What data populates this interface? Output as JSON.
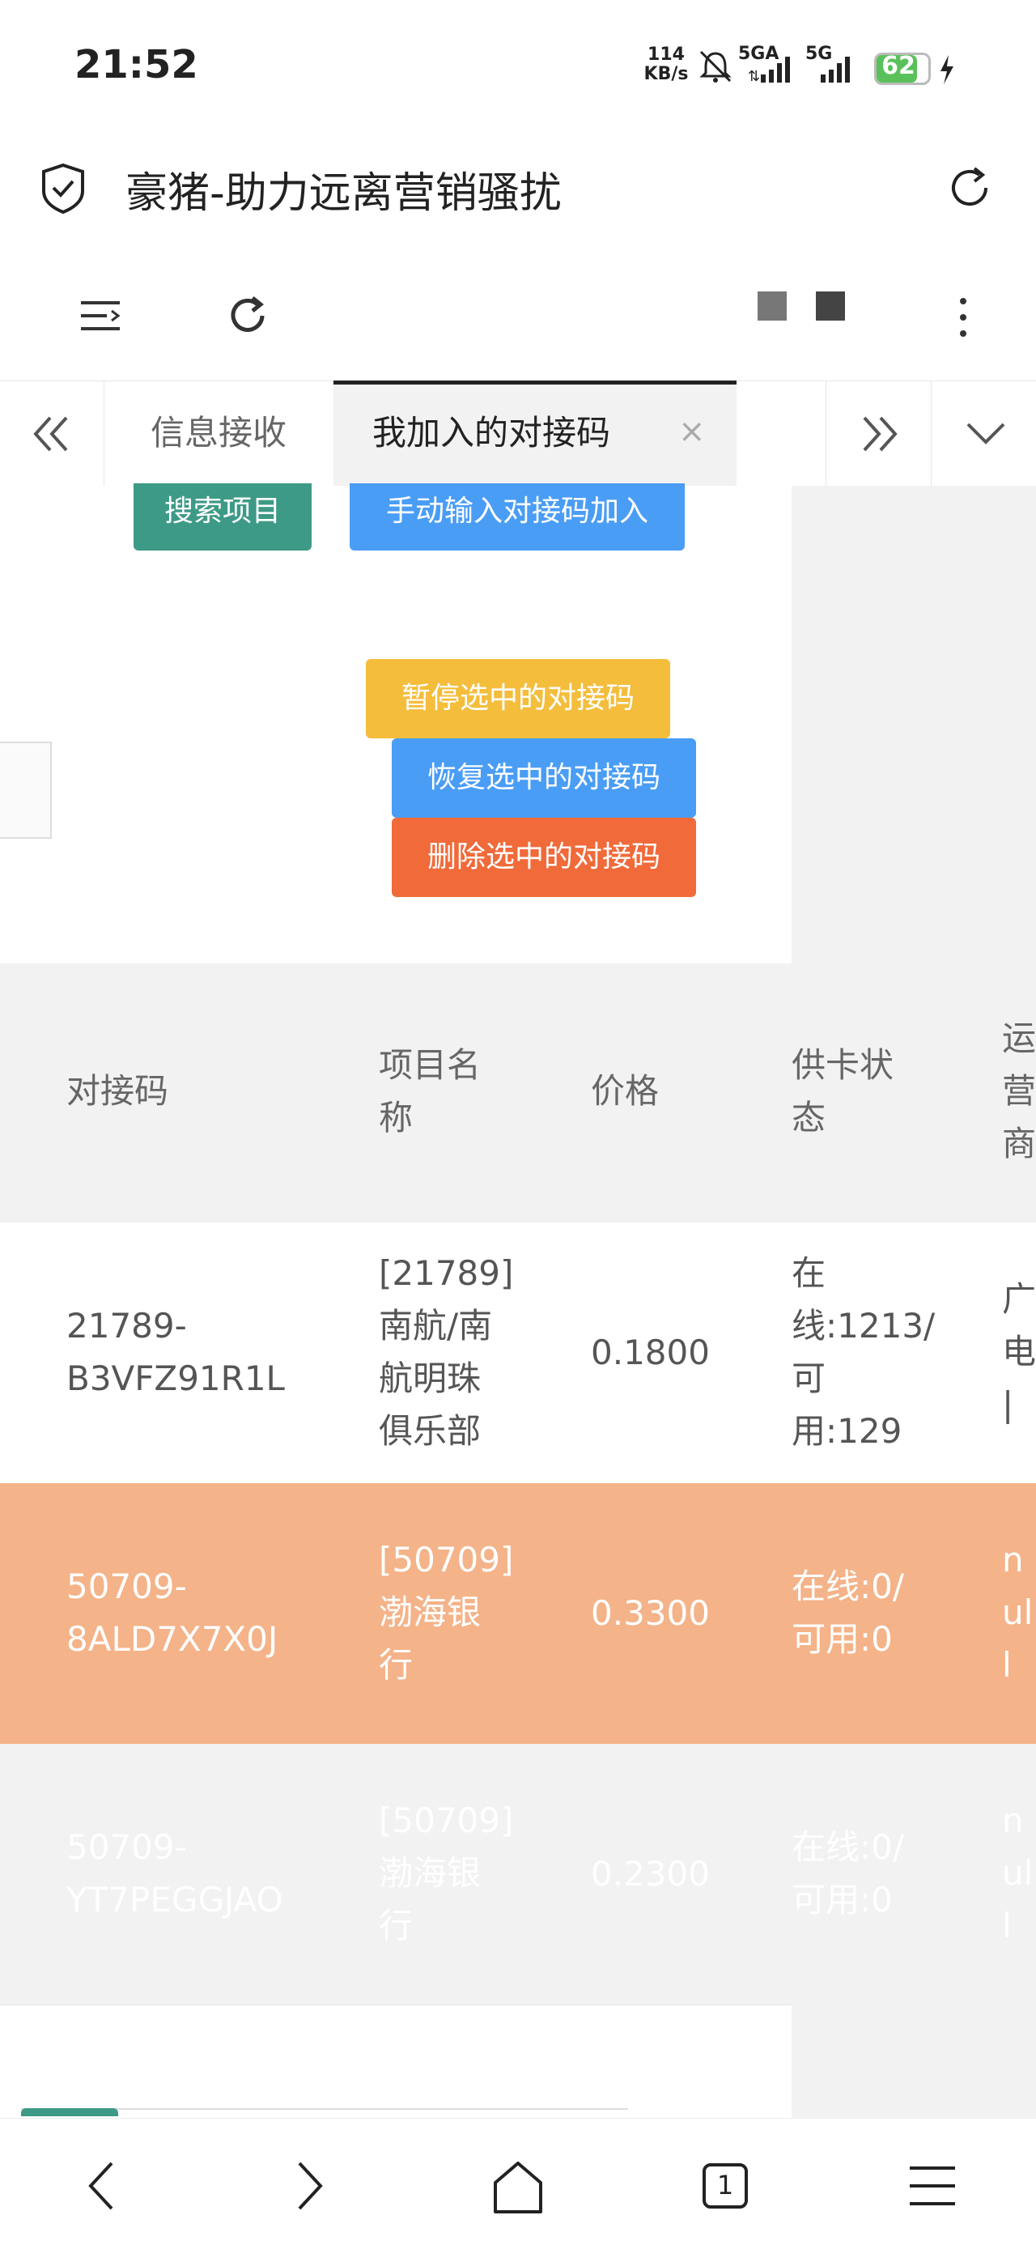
{
  "status_bar": {
    "time": "21:52",
    "net_speed_value": "114",
    "net_speed_unit": "KB/s",
    "signal1_label": "5GA",
    "signal2_label": "5G",
    "battery": "62"
  },
  "browser": {
    "title": "豪猪-助力远离营销骚扰"
  },
  "tabs": {
    "info": "信息接收",
    "active": "我加入的对接码",
    "close": "×"
  },
  "buttons": {
    "search": "搜索项目",
    "manual": "手动输入对接码加入",
    "pause": "暂停选中的对接码",
    "resume": "恢复选中的对接码",
    "delete": "删除选中的对接码"
  },
  "table": {
    "headers": [
      "对接码",
      "项目名\n称",
      "价格",
      "供卡状\n态",
      "运\n营\n商"
    ],
    "rows": [
      [
        "21789-\nB3VFZ91R1L",
        "[21789]\n南航/南\n航明珠\n俱乐部",
        "0.1800",
        "在\n线:1213/\n可\n用:129",
        "广\n电\n|"
      ],
      [
        "50709-\n8ALD7X7X0J",
        "[50709]\n渤海银\n行",
        "0.3300",
        "在线:0/\n可用:0",
        "n\nul\nl"
      ],
      [
        "50709-\nYT7PEGGJAO",
        "[50709]\n渤海银\n行",
        "0.2300",
        "在线:0/\n可用:0",
        "n\nul\nl"
      ]
    ]
  },
  "bottom_nav": {
    "tabs_count": "1"
  },
  "colors": {
    "green": "#3d9a86",
    "blue": "#4a9df5",
    "yellow": "#f4bd3c",
    "red": "#f06a3a",
    "selected_row": "#f4b389"
  }
}
